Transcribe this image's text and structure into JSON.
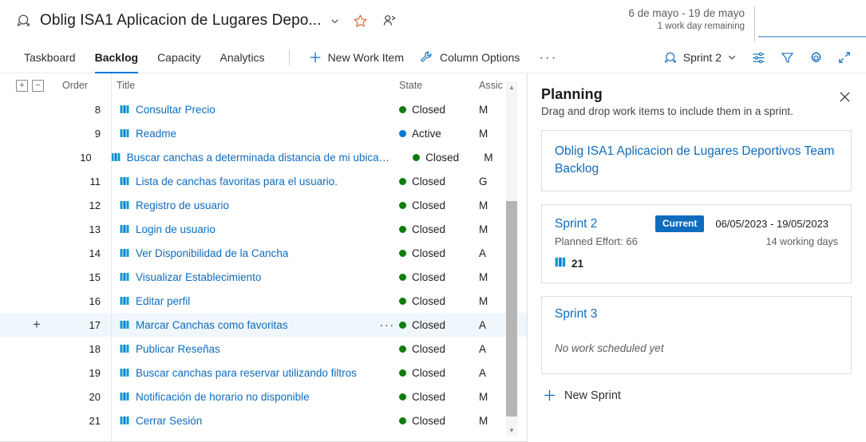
{
  "header": {
    "title": "Oblig ISA1 Aplicacion de Lugares Depo...",
    "iteration_range": "6 de mayo - 19 de mayo",
    "remaining": "1 work day remaining"
  },
  "tabs": [
    {
      "label": "Taskboard",
      "active": false
    },
    {
      "label": "Backlog",
      "active": true
    },
    {
      "label": "Capacity",
      "active": false
    },
    {
      "label": "Analytics",
      "active": false
    }
  ],
  "commands": {
    "new_work_item": "New Work Item",
    "column_options": "Column Options",
    "overflow": "···",
    "sprint_picker": "Sprint 2"
  },
  "grid": {
    "columns": {
      "order": "Order",
      "title": "Title",
      "state": "State",
      "assigned": "Assic"
    },
    "rows": [
      {
        "order": "8",
        "title": "Consultar Precio",
        "state": "Closed",
        "assigned": "M",
        "selected": false
      },
      {
        "order": "9",
        "title": "Readme",
        "state": "Active",
        "assigned": "M",
        "selected": false
      },
      {
        "order": "10",
        "title": "Buscar canchas a determinada distancia de mi ubicación act...",
        "state": "Closed",
        "assigned": "M",
        "selected": false
      },
      {
        "order": "11",
        "title": "Lista de canchas favoritas para el usuario.",
        "state": "Closed",
        "assigned": "G",
        "selected": false
      },
      {
        "order": "12",
        "title": "Registro de usuario",
        "state": "Closed",
        "assigned": "M",
        "selected": false
      },
      {
        "order": "13",
        "title": "Login de usuario",
        "state": "Closed",
        "assigned": "M",
        "selected": false
      },
      {
        "order": "14",
        "title": "Ver Disponibilidad de la Cancha",
        "state": "Closed",
        "assigned": "A",
        "selected": false
      },
      {
        "order": "15",
        "title": "Visualizar Establecimiento",
        "state": "Closed",
        "assigned": "M",
        "selected": false
      },
      {
        "order": "16",
        "title": "Editar perfil",
        "state": "Closed",
        "assigned": "M",
        "selected": false
      },
      {
        "order": "17",
        "title": "Marcar Canchas como favoritas",
        "state": "Closed",
        "assigned": "A",
        "selected": true
      },
      {
        "order": "18",
        "title": "Publicar Reseñas",
        "state": "Closed",
        "assigned": "A",
        "selected": false
      },
      {
        "order": "19",
        "title": "Buscar canchas para reservar utilizando filtros",
        "state": "Closed",
        "assigned": "A",
        "selected": false
      },
      {
        "order": "20",
        "title": "Notificación de horario no disponible",
        "state": "Closed",
        "assigned": "M",
        "selected": false
      },
      {
        "order": "21",
        "title": "Cerrar Sesión",
        "state": "Closed",
        "assigned": "M",
        "selected": false
      }
    ]
  },
  "planning": {
    "title": "Planning",
    "subtitle": "Drag and drop work items to include them in a sprint.",
    "backlog_card": "Oblig ISA1 Aplicacion de Lugares Deportivos Team Backlog",
    "sprints": [
      {
        "name": "Sprint 2",
        "badge": "Current",
        "dates": "06/05/2023 - 19/05/2023",
        "effort": "Planned Effort: 66",
        "working_days": "14 working days",
        "count": "21"
      },
      {
        "name": "Sprint 3",
        "empty_text": "No work scheduled yet"
      }
    ],
    "new_sprint": "New Sprint"
  },
  "colors": {
    "accent": "#0f6cbd",
    "closed": "#107c10",
    "active": "#0078d4",
    "badge": "#0f6cbd"
  }
}
